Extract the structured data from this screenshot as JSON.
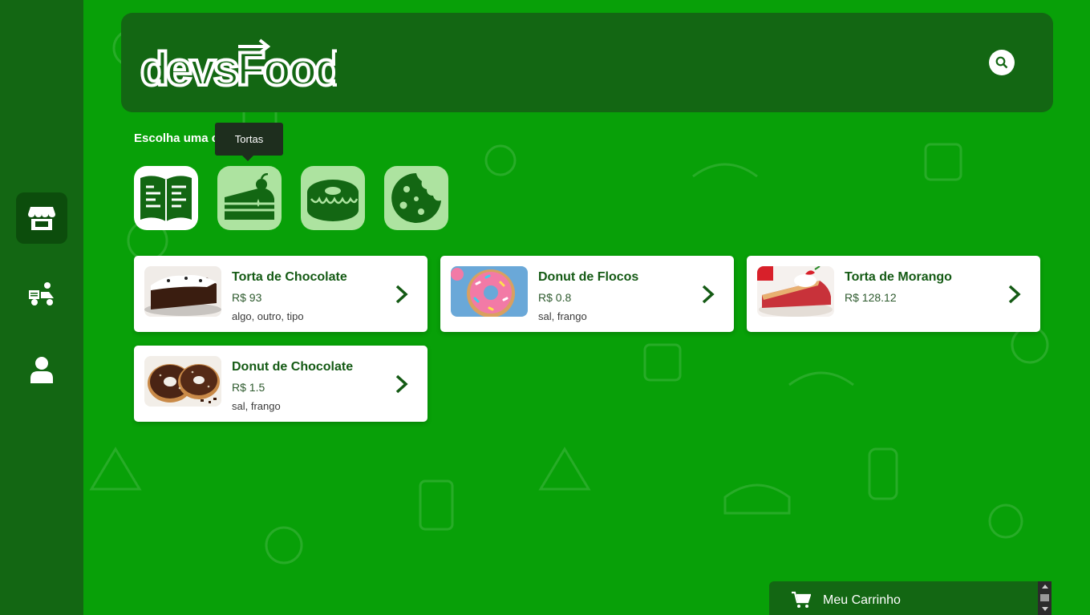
{
  "sidebar": {
    "items": [
      {
        "icon": "store-icon",
        "active": true
      },
      {
        "icon": "delivery-icon",
        "active": false
      },
      {
        "icon": "user-icon",
        "active": false
      }
    ]
  },
  "header": {
    "logo_text": "devsFood",
    "search_icon": "search-icon"
  },
  "categories": {
    "title": "Escolha uma categoria",
    "tooltip": "Tortas",
    "items": [
      {
        "name": "Todas",
        "icon": "menu-book-icon",
        "selected": true
      },
      {
        "name": "Tortas",
        "icon": "cake-slice-icon",
        "selected": false
      },
      {
        "name": "Donuts",
        "icon": "donut-icon",
        "selected": false
      },
      {
        "name": "Cookies",
        "icon": "cookie-icon",
        "selected": false
      }
    ]
  },
  "products": [
    {
      "name": "Torta de Chocolate",
      "price": "R$ 93",
      "ingredients": "algo, outro, tipo",
      "image": "chocolate-pie-image"
    },
    {
      "name": "Donut de Flocos",
      "price": "R$ 0.8",
      "ingredients": "sal, frango",
      "image": "sprinkle-donut-image"
    },
    {
      "name": "Torta de Morango",
      "price": "R$ 128.12",
      "ingredients": "",
      "image": "strawberry-pie-image"
    },
    {
      "name": "Donut de Chocolate",
      "price": "R$ 1.5",
      "ingredients": "sal, frango",
      "image": "chocolate-donut-image"
    }
  ],
  "cart": {
    "label": "Meu Carrinho",
    "icon": "cart-icon"
  },
  "colors": {
    "background": "#08a008",
    "dark_green": "#136713",
    "accent_text": "#145a14"
  }
}
